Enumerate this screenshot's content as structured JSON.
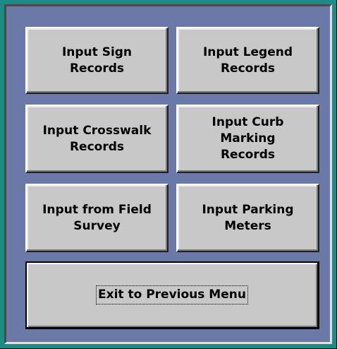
{
  "menu": {
    "buttons": {
      "sign": "Input Sign\nRecords",
      "legend": "Input Legend\nRecords",
      "crosswalk": "Input Crosswalk\nRecords",
      "curb": "Input Curb\nMarking\nRecords",
      "field": "Input from Field\nSurvey",
      "meters": "Input Parking\nMeters"
    },
    "exit_label": "Exit to Previous Menu"
  },
  "colors": {
    "frame": "#1c8b85",
    "panel": "#6b79a8",
    "button_face": "#c8c8c8"
  }
}
